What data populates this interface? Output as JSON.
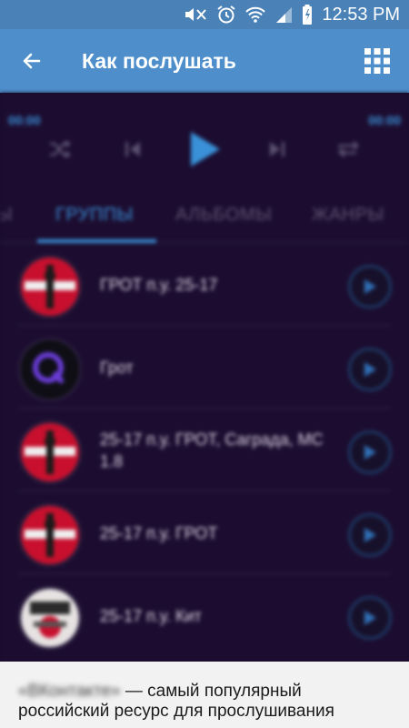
{
  "status_bar": {
    "time": "12:53 PM",
    "icons": [
      "mute-icon",
      "alarm-icon",
      "wifi-icon",
      "signal-icon",
      "battery-charging-icon"
    ]
  },
  "app_bar": {
    "title": "Как послушать",
    "back_icon": "arrow-back-icon",
    "menu_icon": "grid-icon"
  },
  "player": {
    "elapsed": "00:00",
    "duration": "00:00",
    "controls": [
      "shuffle-icon",
      "previous-icon",
      "play-icon",
      "next-icon",
      "repeat-icon"
    ]
  },
  "tabs": [
    {
      "label": "Ы",
      "active": false
    },
    {
      "label": "ГРУППЫ",
      "active": true
    },
    {
      "label": "АЛЬБОМЫ",
      "active": false
    },
    {
      "label": "ЖАНРЫ",
      "active": false
    }
  ],
  "groups": [
    {
      "name": "ГРОТ п.у. 25-17",
      "avatar": "red-logo"
    },
    {
      "name": "Грот",
      "avatar": "q-logo"
    },
    {
      "name": "25-17 п.у. ГРОТ, Сагрaда, MC 1.8",
      "avatar": "red-logo"
    },
    {
      "name": "25-17 п.у. ГРОТ",
      "avatar": "red-logo"
    },
    {
      "name": "25-17 п.у. Кит",
      "avatar": "white-logo"
    }
  ],
  "colors": {
    "accent": "#3a91d8",
    "app_bar": "#4e8fcb",
    "status_bar": "#4a82b8",
    "background": "#1c0d30"
  },
  "sheet": {
    "lead_blurred": "«ВКонтакте»",
    "text": " — самый популярный российский ресурс для прослушивания"
  }
}
